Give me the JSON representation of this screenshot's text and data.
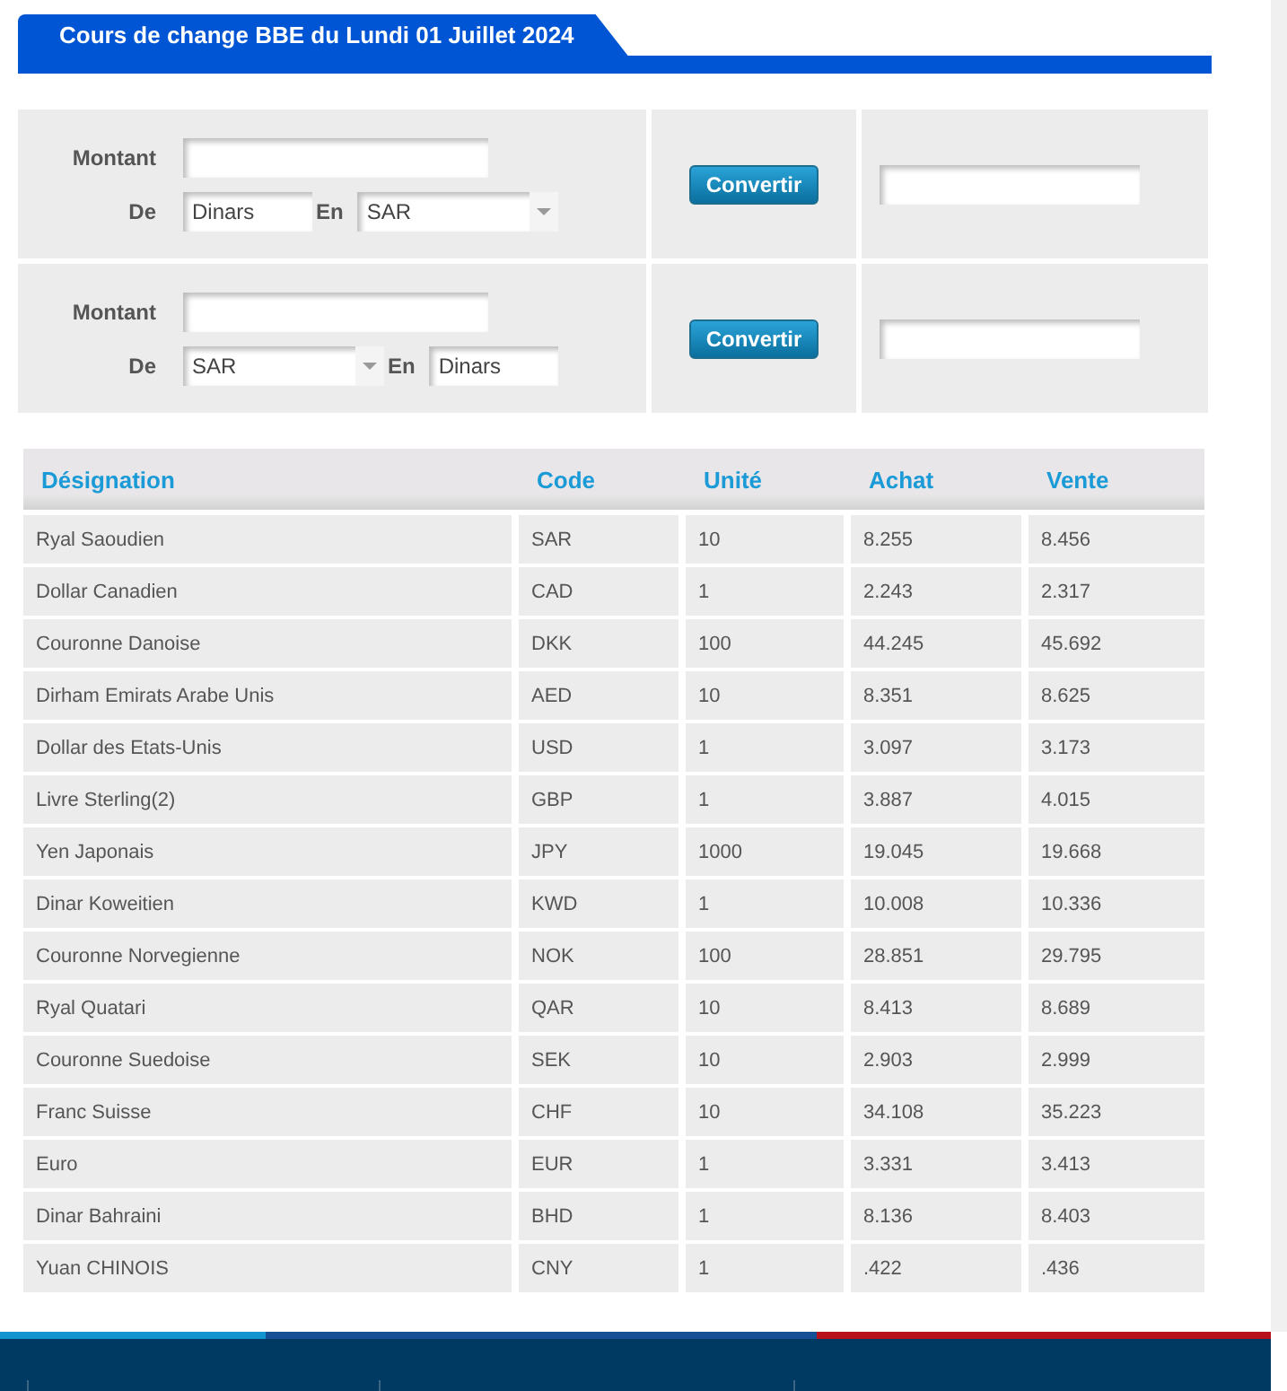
{
  "title": "Cours de change BBE du Lundi 01 Juillet 2024",
  "converters": [
    {
      "amount_label": "Montant",
      "from_label": "De",
      "from": {
        "kind": "text",
        "value": "Dinars"
      },
      "to_label": "En",
      "to": {
        "kind": "select",
        "value": "SAR"
      },
      "button": "Convertir"
    },
    {
      "amount_label": "Montant",
      "from_label": "De",
      "from": {
        "kind": "select",
        "value": "SAR"
      },
      "to_label": "En",
      "to": {
        "kind": "text",
        "value": "Dinars"
      },
      "button": "Convertir"
    }
  ],
  "table": {
    "columns": [
      "Désignation",
      "Code",
      "Unité",
      "Achat",
      "Vente"
    ],
    "rows": [
      [
        "Ryal Saoudien",
        "SAR",
        "10",
        "8.255",
        "8.456"
      ],
      [
        "Dollar Canadien",
        "CAD",
        "1",
        "2.243",
        "2.317"
      ],
      [
        "Couronne Danoise",
        "DKK",
        "100",
        "44.245",
        "45.692"
      ],
      [
        "Dirham Emirats Arabe Unis",
        "AED",
        "10",
        "8.351",
        "8.625"
      ],
      [
        "Dollar des Etats-Unis",
        "USD",
        "1",
        "3.097",
        "3.173"
      ],
      [
        "Livre Sterling(2)",
        "GBP",
        "1",
        "3.887",
        "4.015"
      ],
      [
        "Yen Japonais",
        "JPY",
        "1000",
        "19.045",
        "19.668"
      ],
      [
        "Dinar Koweitien",
        "KWD",
        "1",
        "10.008",
        "10.336"
      ],
      [
        "Couronne Norvegienne",
        "NOK",
        "100",
        "28.851",
        "29.795"
      ],
      [
        "Ryal Quatari",
        "QAR",
        "10",
        "8.413",
        "8.689"
      ],
      [
        "Couronne Suedoise",
        "SEK",
        "10",
        "2.903",
        "2.999"
      ],
      [
        "Franc Suisse",
        "CHF",
        "10",
        "34.108",
        "35.223"
      ],
      [
        "Euro",
        "EUR",
        "1",
        "3.331",
        "3.413"
      ],
      [
        "Dinar Bahraini",
        "BHD",
        "1",
        "8.136",
        "8.403"
      ],
      [
        "Yuan CHINOIS",
        "CNY",
        "1",
        ".422",
        ".436"
      ]
    ]
  }
}
